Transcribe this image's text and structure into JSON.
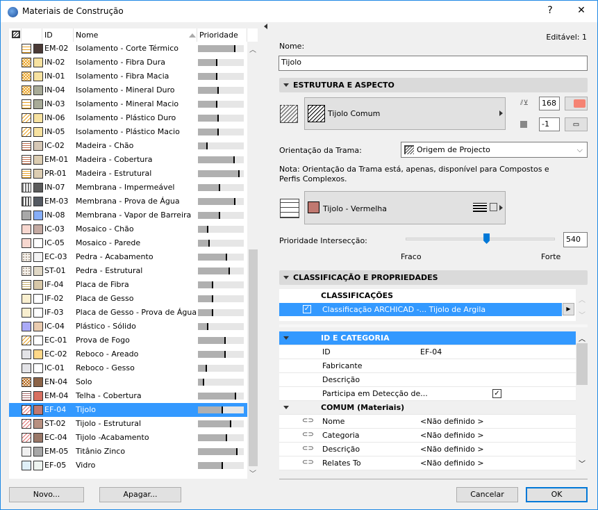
{
  "window": {
    "title": "Materiais de Construção",
    "help": "?",
    "close": "✕"
  },
  "list": {
    "headers": {
      "id": "ID",
      "name": "Nome",
      "priority": "Prioridade"
    },
    "rows": [
      {
        "id": "EM-02",
        "name": "Isolamento - Corte Térmico",
        "priority": 0.82,
        "pattern": "grid",
        "pc": "#e8a020",
        "color": "#4a3a36"
      },
      {
        "id": "IN-02",
        "name": "Isolamento - Fibra Dura",
        "priority": 0.42,
        "pattern": "cross",
        "pc": "#e8a020",
        "color": "#f7e2a0"
      },
      {
        "id": "IN-01",
        "name": "Isolamento - Fibra Macia",
        "priority": 0.42,
        "pattern": "cross",
        "pc": "#e8a020",
        "color": "#f7e2a0"
      },
      {
        "id": "IN-04",
        "name": "Isolamento - Mineral Duro",
        "priority": 0.45,
        "pattern": "cross",
        "pc": "#e8a020",
        "color": "#a8ab98"
      },
      {
        "id": "IN-03",
        "name": "Isolamento - Mineral Macio",
        "priority": 0.43,
        "pattern": "grid",
        "pc": "#e8a020",
        "color": "#a8ab98"
      },
      {
        "id": "IN-06",
        "name": "Isolamento - Plástico Duro",
        "priority": 0.46,
        "pattern": "diag",
        "pc": "#e8a020",
        "color": "#f7e2a0"
      },
      {
        "id": "IN-05",
        "name": "Isolamento - Plástico Macio",
        "priority": 0.45,
        "pattern": "diag",
        "pc": "#e8a020",
        "color": "#f7e2a0"
      },
      {
        "id": "IC-02",
        "name": "Madeira - Chão",
        "priority": 0.21,
        "pattern": "hline",
        "pc": "#c07050",
        "color": "#d6c8b6"
      },
      {
        "id": "EM-01",
        "name": "Madeira - Cobertura",
        "priority": 0.81,
        "pattern": "hline",
        "pc": "#c07050",
        "color": "#dccdb2"
      },
      {
        "id": "PR-01",
        "name": "Madeira - Estrutural",
        "priority": 0.91,
        "pattern": "hline",
        "pc": "#e8a020",
        "color": "#dccdb2"
      },
      {
        "id": "IN-07",
        "name": "Membrana - Impermeável",
        "priority": 0.48,
        "pattern": "vline",
        "pc": "#777777",
        "color": "#5c5c5c"
      },
      {
        "id": "EM-03",
        "name": "Membrana - Prova de Água",
        "priority": 0.82,
        "pattern": "vline",
        "pc": "#555555",
        "color": "#555a62"
      },
      {
        "id": "IN-08",
        "name": "Membrana - Vapor de Barreira",
        "priority": 0.48,
        "pattern": "solid",
        "pc": "#a8a8a8",
        "color": "#86aef8"
      },
      {
        "id": "IC-03",
        "name": "Mosaico - Chão",
        "priority": 0.23,
        "pattern": "dots",
        "pc": "#e06040",
        "color": "#c4aaa2"
      },
      {
        "id": "IC-05",
        "name": "Mosaico - Parede",
        "priority": 0.25,
        "pattern": "dots",
        "pc": "#e06040",
        "color": "#ffffff"
      },
      {
        "id": "EC-03",
        "name": "Pedra - Acabamento",
        "priority": 0.63,
        "pattern": "sparse",
        "pc": "#a09080",
        "color": "#f4f4f4"
      },
      {
        "id": "ST-01",
        "name": "Pedra - Estrutural",
        "priority": 0.7,
        "pattern": "sparse",
        "pc": "#a09080",
        "color": "#e0d8c6"
      },
      {
        "id": "IF-04",
        "name": "Placa de Fibra",
        "priority": 0.34,
        "pattern": "hline",
        "pc": "#c8b070",
        "color": "#d8c8a8"
      },
      {
        "id": "IF-02",
        "name": "Placa de Gesso",
        "priority": 0.33,
        "pattern": "dots",
        "pc": "#e8c040",
        "color": "#ffffff"
      },
      {
        "id": "IF-03",
        "name": "Placa de Gesso - Prova de Água",
        "priority": 0.33,
        "pattern": "dots",
        "pc": "#e8c040",
        "color": "#ffffff"
      },
      {
        "id": "IC-04",
        "name": "Plástico - Sólido",
        "priority": 0.23,
        "pattern": "solid",
        "pc": "#aaaaf8",
        "color": "#eaccb0"
      },
      {
        "id": "EC-01",
        "name": "Prova de Fogo",
        "priority": 0.61,
        "pattern": "diag",
        "pc": "#e8a020",
        "color": "#ffffff"
      },
      {
        "id": "EC-02",
        "name": "Reboco - Areado",
        "priority": 0.61,
        "pattern": "dots",
        "pc": "#9090a0",
        "color": "#ffd888"
      },
      {
        "id": "IC-01",
        "name": "Reboco - Gesso",
        "priority": 0.2,
        "pattern": "dots",
        "pc": "#9090a0",
        "color": "#ffffff"
      },
      {
        "id": "EN-04",
        "name": "Solo",
        "priority": 0.14,
        "pattern": "cross",
        "pc": "#b06010",
        "color": "#8c6448"
      },
      {
        "id": "EM-04",
        "name": "Telha - Cobertura",
        "priority": 0.84,
        "pattern": "hline",
        "pc": "#b07070",
        "color": "#d87060"
      },
      {
        "id": "EF-04",
        "name": "Tijolo",
        "priority": 0.54,
        "pattern": "diag",
        "pc": "#e07070",
        "color": "#c07870",
        "selected": true
      },
      {
        "id": "ST-02",
        "name": "Tijolo - Estrutural",
        "priority": 0.72,
        "pattern": "diag",
        "pc": "#e07070",
        "color": "#b89080"
      },
      {
        "id": "EC-04",
        "name": "Tijolo -Acabamento",
        "priority": 0.64,
        "pattern": "diag",
        "pc": "#e07070",
        "color": "#9a7868"
      },
      {
        "id": "EM-05",
        "name": "Titânio Zinco",
        "priority": 0.86,
        "pattern": "solid",
        "pc": "#f0f0f0",
        "color": "#a8a8a8"
      },
      {
        "id": "EF-05",
        "name": "Vidro",
        "priority": 0.55,
        "pattern": "dots",
        "pc": "#80c0e0",
        "color": "#eef4f0"
      }
    ]
  },
  "buttons": {
    "new": "Novo...",
    "delete": "Apagar...",
    "cancel": "Cancelar",
    "ok": "OK"
  },
  "details": {
    "editable": "Editável: 1",
    "name_label": "Nome:",
    "name_value": "Tijolo",
    "section1": "ESTRUTURA E ASPECTO",
    "cut_fill": "Tijolo Comum",
    "pen1": "168",
    "pen2": "-1",
    "pen_color": "#f58373",
    "orientation_label": "Orientação da Trama:",
    "orientation_value": "Origem de Projecto",
    "note": "Nota: Orientação da Trama está, apenas, disponível para Compostos e Perfis Complexos.",
    "surface": "Tijolo - Vermelha",
    "surface_color": "#c07870",
    "priority_label": "Prioridade Intersecção:",
    "priority_value": "540",
    "priority_fraction": 0.54,
    "weak": "Fraco",
    "strong": "Forte",
    "section2": "CLASSIFICAÇÃO E PROPRIEDADES",
    "classifications_header": "CLASSIFICAÇÕES",
    "classification": "Classificação ARCHICAD -... Tijolo de Argila",
    "props": {
      "group1": "ID E CATEGORIA",
      "rows1": [
        {
          "k": "ID",
          "v": "EF-04"
        },
        {
          "k": "Fabricante",
          "v": ""
        },
        {
          "k": "Descrição",
          "v": ""
        },
        {
          "k": "Participa em Detecção de...",
          "v": "",
          "check": true
        }
      ],
      "group2": "COMUM (Materiais)",
      "rows2": [
        {
          "k": "Nome",
          "v": "<Não definido >"
        },
        {
          "k": "Categoria",
          "v": "<Não definido >"
        },
        {
          "k": "Descrição",
          "v": "<Não definido >"
        },
        {
          "k": "Relates To",
          "v": "<Não definido >"
        }
      ]
    }
  }
}
